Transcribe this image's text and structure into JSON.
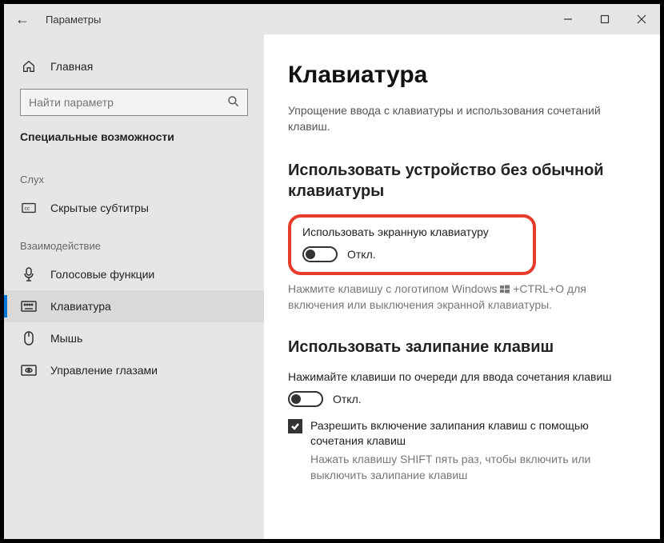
{
  "titlebar": {
    "back_aria": "Back",
    "title": "Параметры"
  },
  "sidebar": {
    "home": "Главная",
    "search_placeholder": "Найти параметр",
    "current_area": "Специальные возможности",
    "group_hearing": "Слух",
    "group_interaction": "Взаимодействие",
    "items": {
      "captions": "Скрытые субтитры",
      "speech": "Голосовые функции",
      "keyboard": "Клавиатура",
      "mouse": "Мышь",
      "eye": "Управление глазами"
    }
  },
  "main": {
    "title": "Клавиатура",
    "desc": "Упрощение ввода с клавиатуры и использования сочетаний клавиш.",
    "section1": "Использовать устройство без обычной клавиатуры",
    "osk_label": "Использовать экранную клавиатуру",
    "off": "Откл.",
    "osk_hint_pre": "Нажмите клавишу с логотипом Windows ",
    "osk_hint_post": " +CTRL+O для включения или выключения экранной клавиатуры.",
    "section2": "Использовать залипание клавиш",
    "sticky_label": "Нажимайте клавиши по очереди для ввода сочетания клавиш",
    "sticky_check": "Разрешить включение залипания клавиш с помощью сочетания клавиш",
    "sticky_hint": "Нажать клавишу SHIFT пять раз, чтобы включить или выключить залипание клавиш"
  }
}
